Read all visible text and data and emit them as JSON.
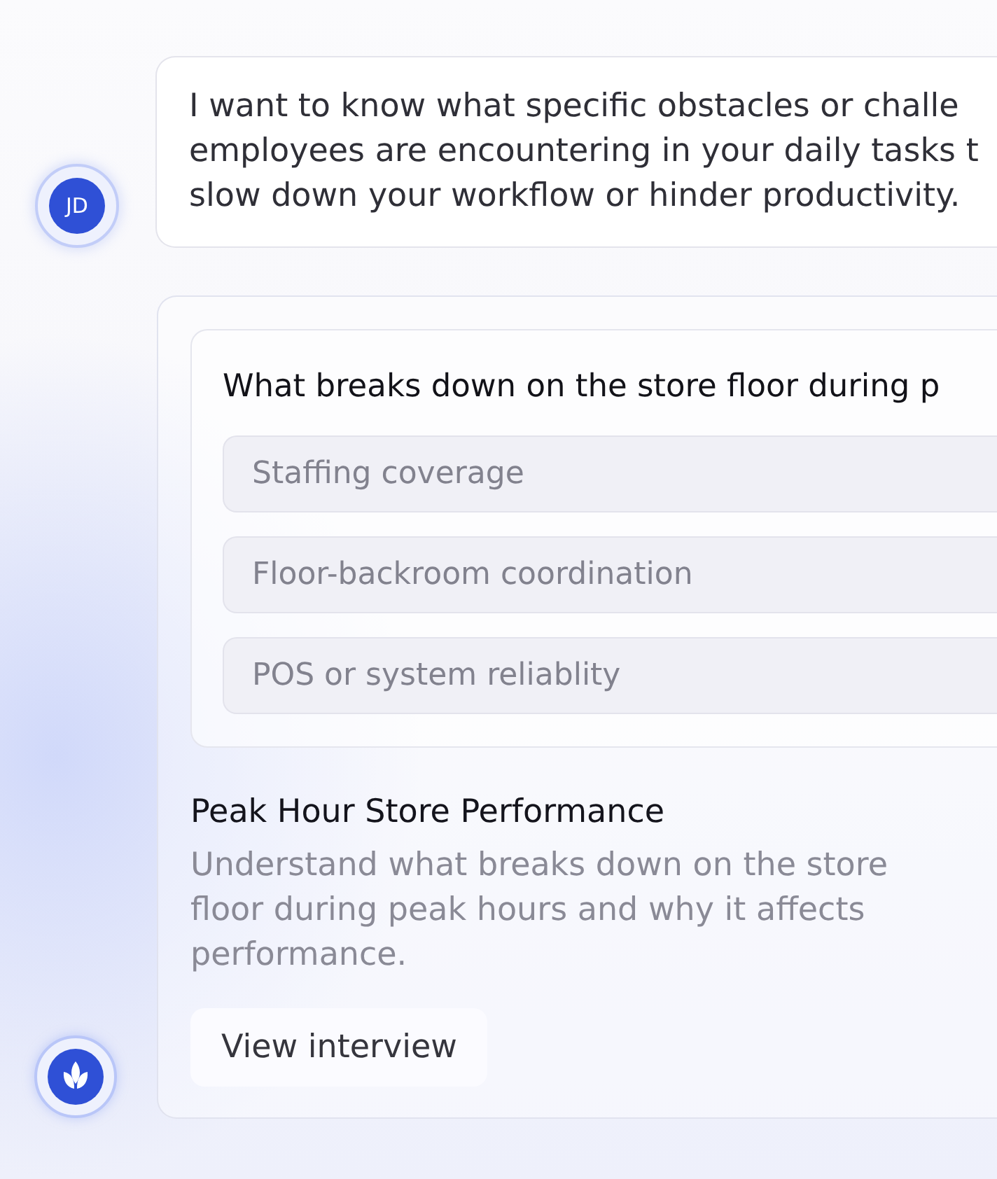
{
  "messages": [
    {
      "kind": "user",
      "avatar": {
        "initials": "JD"
      },
      "lines": [
        "I want to know what specific obstacles or challe",
        "employees are encountering in your daily tasks t",
        "slow down your workflow or hinder productivity."
      ]
    },
    {
      "kind": "interview_card",
      "question": {
        "title": "What breaks down on the store floor during p",
        "options": [
          {
            "label": "Staffing coverage",
            "selected": false
          },
          {
            "label": "Floor-backroom coordination",
            "selected": false
          },
          {
            "label": "POS or system reliablity",
            "selected": false
          }
        ]
      },
      "title": "Peak Hour Store Performance",
      "description": "Understand what breaks down on the store floor during peak hours and why it affects performance.",
      "button": "View interview"
    }
  ]
}
